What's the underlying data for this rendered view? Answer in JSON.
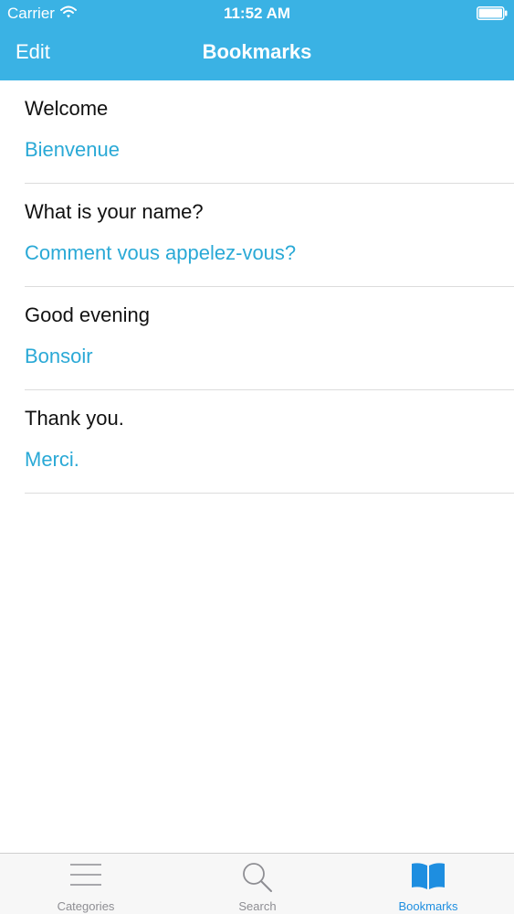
{
  "status_bar": {
    "carrier": "Carrier",
    "time": "11:52 AM",
    "icons": [
      "wifi-icon",
      "battery-icon"
    ]
  },
  "nav": {
    "edit_label": "Edit",
    "title": "Bookmarks"
  },
  "bookmarks": [
    {
      "english": "Welcome",
      "french": "Bienvenue"
    },
    {
      "english": "What is your name?",
      "french": "Comment vous appelez-vous?"
    },
    {
      "english": "Good evening",
      "french": "Bonsoir"
    },
    {
      "english": "Thank you.",
      "french": "Merci."
    }
  ],
  "tab_bar": {
    "tabs": [
      {
        "label": "Categories",
        "icon": "list-icon",
        "active": false
      },
      {
        "label": "Search",
        "icon": "search-icon",
        "active": false
      },
      {
        "label": "Bookmarks",
        "icon": "book-icon",
        "active": true
      }
    ]
  },
  "colors": {
    "header_bg": "#3ab2e4",
    "translation_text": "#2aa9d6",
    "active_tab": "#1e8ee0",
    "inactive_tab": "#8e8e93"
  }
}
